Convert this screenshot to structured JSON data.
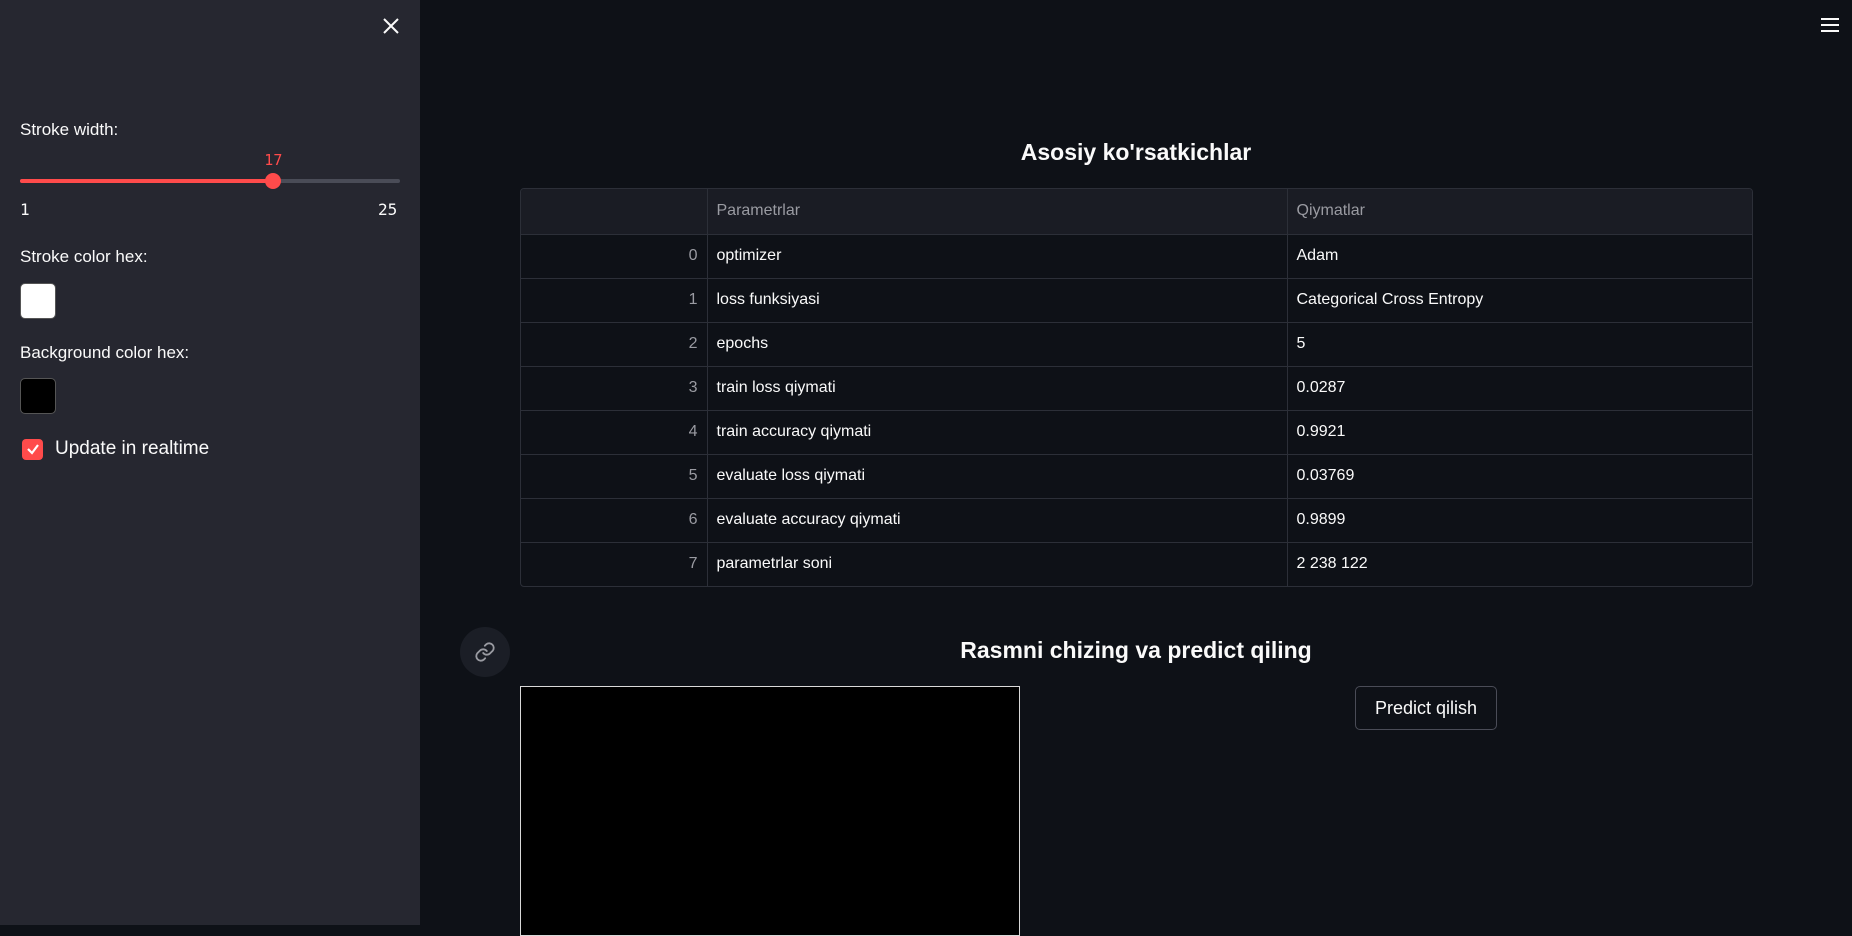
{
  "sidebar": {
    "stroke_width_label": "Stroke width:",
    "stroke_width": {
      "value": 17,
      "min": 1,
      "max": 25,
      "value_text": "17",
      "min_text": "1",
      "max_text": "25"
    },
    "stroke_color_label": "Stroke color hex:",
    "stroke_color": "#FFFFFF",
    "background_color_label": "Background color hex:",
    "background_color": "#000000",
    "realtime_label": "Update in realtime",
    "realtime_checked": true,
    "close_icon": "close-icon"
  },
  "header": {
    "menu_icon": "hamburger-menu-icon"
  },
  "metrics": {
    "title": "Asosiy ko'rsatkichlar",
    "columns": [
      "",
      "Parametrlar",
      "Qiymatlar"
    ],
    "rows": [
      [
        "0",
        "optimizer",
        "Adam"
      ],
      [
        "1",
        "loss funksiyasi",
        "Categorical Cross Entropy"
      ],
      [
        "2",
        "epochs",
        "5"
      ],
      [
        "3",
        "train loss qiymati",
        "0.0287"
      ],
      [
        "4",
        "train accuracy qiymati",
        "0.9921"
      ],
      [
        "5",
        "evaluate loss qiymati",
        "0.03769"
      ],
      [
        "6",
        "evaluate accuracy qiymati",
        "0.9899"
      ],
      [
        "7",
        "parametrlar soni",
        "2 238 122"
      ]
    ]
  },
  "draw": {
    "title": "Rasmni chizing va predict qiling",
    "predict_label": "Predict qilish",
    "link_icon": "link-icon"
  },
  "colors": {
    "accent": "#ff4b4b",
    "sidebar_bg": "#262730",
    "main_bg": "#0e1117"
  }
}
